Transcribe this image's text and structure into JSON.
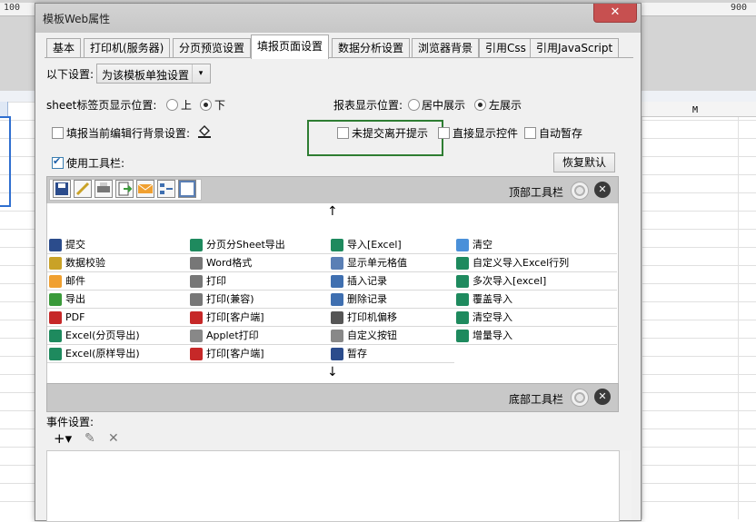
{
  "ruler": {
    "left": "100",
    "right": "900"
  },
  "sheet": {
    "col_m": "M"
  },
  "dialog": {
    "title": "模板Web属性",
    "close": "✕"
  },
  "tabs": [
    {
      "label": "基本"
    },
    {
      "label": "打印机(服务器)"
    },
    {
      "label": "分页预览设置"
    },
    {
      "label": "填报页面设置",
      "active": true
    },
    {
      "label": "数据分析设置"
    },
    {
      "label": "浏览器背景"
    },
    {
      "label": "引用Css"
    },
    {
      "label": "引用JavaScript"
    }
  ],
  "settings": {
    "label": "以下设置:",
    "select_value": "为该模板单独设置",
    "select_arrow": "▾"
  },
  "sheet_pos": {
    "label": "sheet标签页显示位置:",
    "opt_top": "上",
    "opt_bottom": "下"
  },
  "report_pos": {
    "label": "报表显示位置:",
    "opt_center": "居中展示",
    "opt_left": "左展示"
  },
  "checks": {
    "row_bg": "填报当前编辑行背景设置:",
    "no_submit": "未提交离开提示",
    "show_ctrl": "直接显示控件",
    "autosave": "自动暂存",
    "use_toolbar": "使用工具栏:"
  },
  "restore": "恢复默认",
  "top_toolbar": {
    "label": "顶部工具栏"
  },
  "bottom_toolbar": {
    "label": "底部工具栏"
  },
  "arrows": {
    "up": "↑",
    "down": "↓"
  },
  "items": [
    {
      "label": "提交",
      "icon": "save-icon",
      "color": "#2b4c8c"
    },
    {
      "label": "分页分Sheet导出",
      "icon": "excel-icon",
      "color": "#1e8a5e"
    },
    {
      "label": "导入[Excel]",
      "icon": "excel-icon",
      "color": "#1e8a5e"
    },
    {
      "label": "清空",
      "icon": "eraser-icon",
      "color": "#4a90d9"
    },
    {
      "label": "数据校验",
      "icon": "pen-icon",
      "color": "#c9a227"
    },
    {
      "label": "Word格式",
      "icon": "word-icon",
      "color": "#777777"
    },
    {
      "label": "显示单元格值",
      "icon": "cell-icon",
      "color": "#5a7fb5"
    },
    {
      "label": "自定义导入Excel行列",
      "icon": "excel-icon",
      "color": "#1e8a5e"
    },
    {
      "label": "邮件",
      "icon": "mail-icon",
      "color": "#f0a030"
    },
    {
      "label": "打印",
      "icon": "print-icon",
      "color": "#777777"
    },
    {
      "label": "插入记录",
      "icon": "insert-icon",
      "color": "#3f6fb0"
    },
    {
      "label": "多次导入[excel]",
      "icon": "excel-icon",
      "color": "#1e8a5e"
    },
    {
      "label": "导出",
      "icon": "export-icon",
      "color": "#3a9a3a"
    },
    {
      "label": "打印(兼容)",
      "icon": "print-icon",
      "color": "#777777"
    },
    {
      "label": "删除记录",
      "icon": "delete-icon",
      "color": "#3f6fb0"
    },
    {
      "label": "覆盖导入",
      "icon": "excel-icon",
      "color": "#1e8a5e"
    },
    {
      "label": "PDF",
      "icon": "pdf-icon",
      "color": "#c62828"
    },
    {
      "label": "打印[客户端]",
      "icon": "client-print-icon",
      "color": "#c62828"
    },
    {
      "label": "打印机偏移",
      "icon": "move-icon",
      "color": "#555555"
    },
    {
      "label": "清空导入",
      "icon": "excel-icon",
      "color": "#1e8a5e"
    },
    {
      "label": "Excel(分页导出)",
      "icon": "excel-icon",
      "color": "#1e8a5e"
    },
    {
      "label": "Applet打印",
      "icon": "applet-icon",
      "color": "#888888"
    },
    {
      "label": "自定义按钮",
      "icon": "gear-icon",
      "color": "#888888"
    },
    {
      "label": "增量导入",
      "icon": "excel-icon",
      "color": "#1e8a5e"
    },
    {
      "label": "Excel(原样导出)",
      "icon": "excel-icon",
      "color": "#1e8a5e"
    },
    {
      "label": "打印[客户端]",
      "icon": "client-print-icon",
      "color": "#c62828"
    },
    {
      "label": "暂存",
      "icon": "save-icon",
      "color": "#2b4c8c"
    }
  ],
  "events": {
    "label": "事件设置:",
    "add": "+▾",
    "edit": "✎",
    "remove": "✕"
  }
}
